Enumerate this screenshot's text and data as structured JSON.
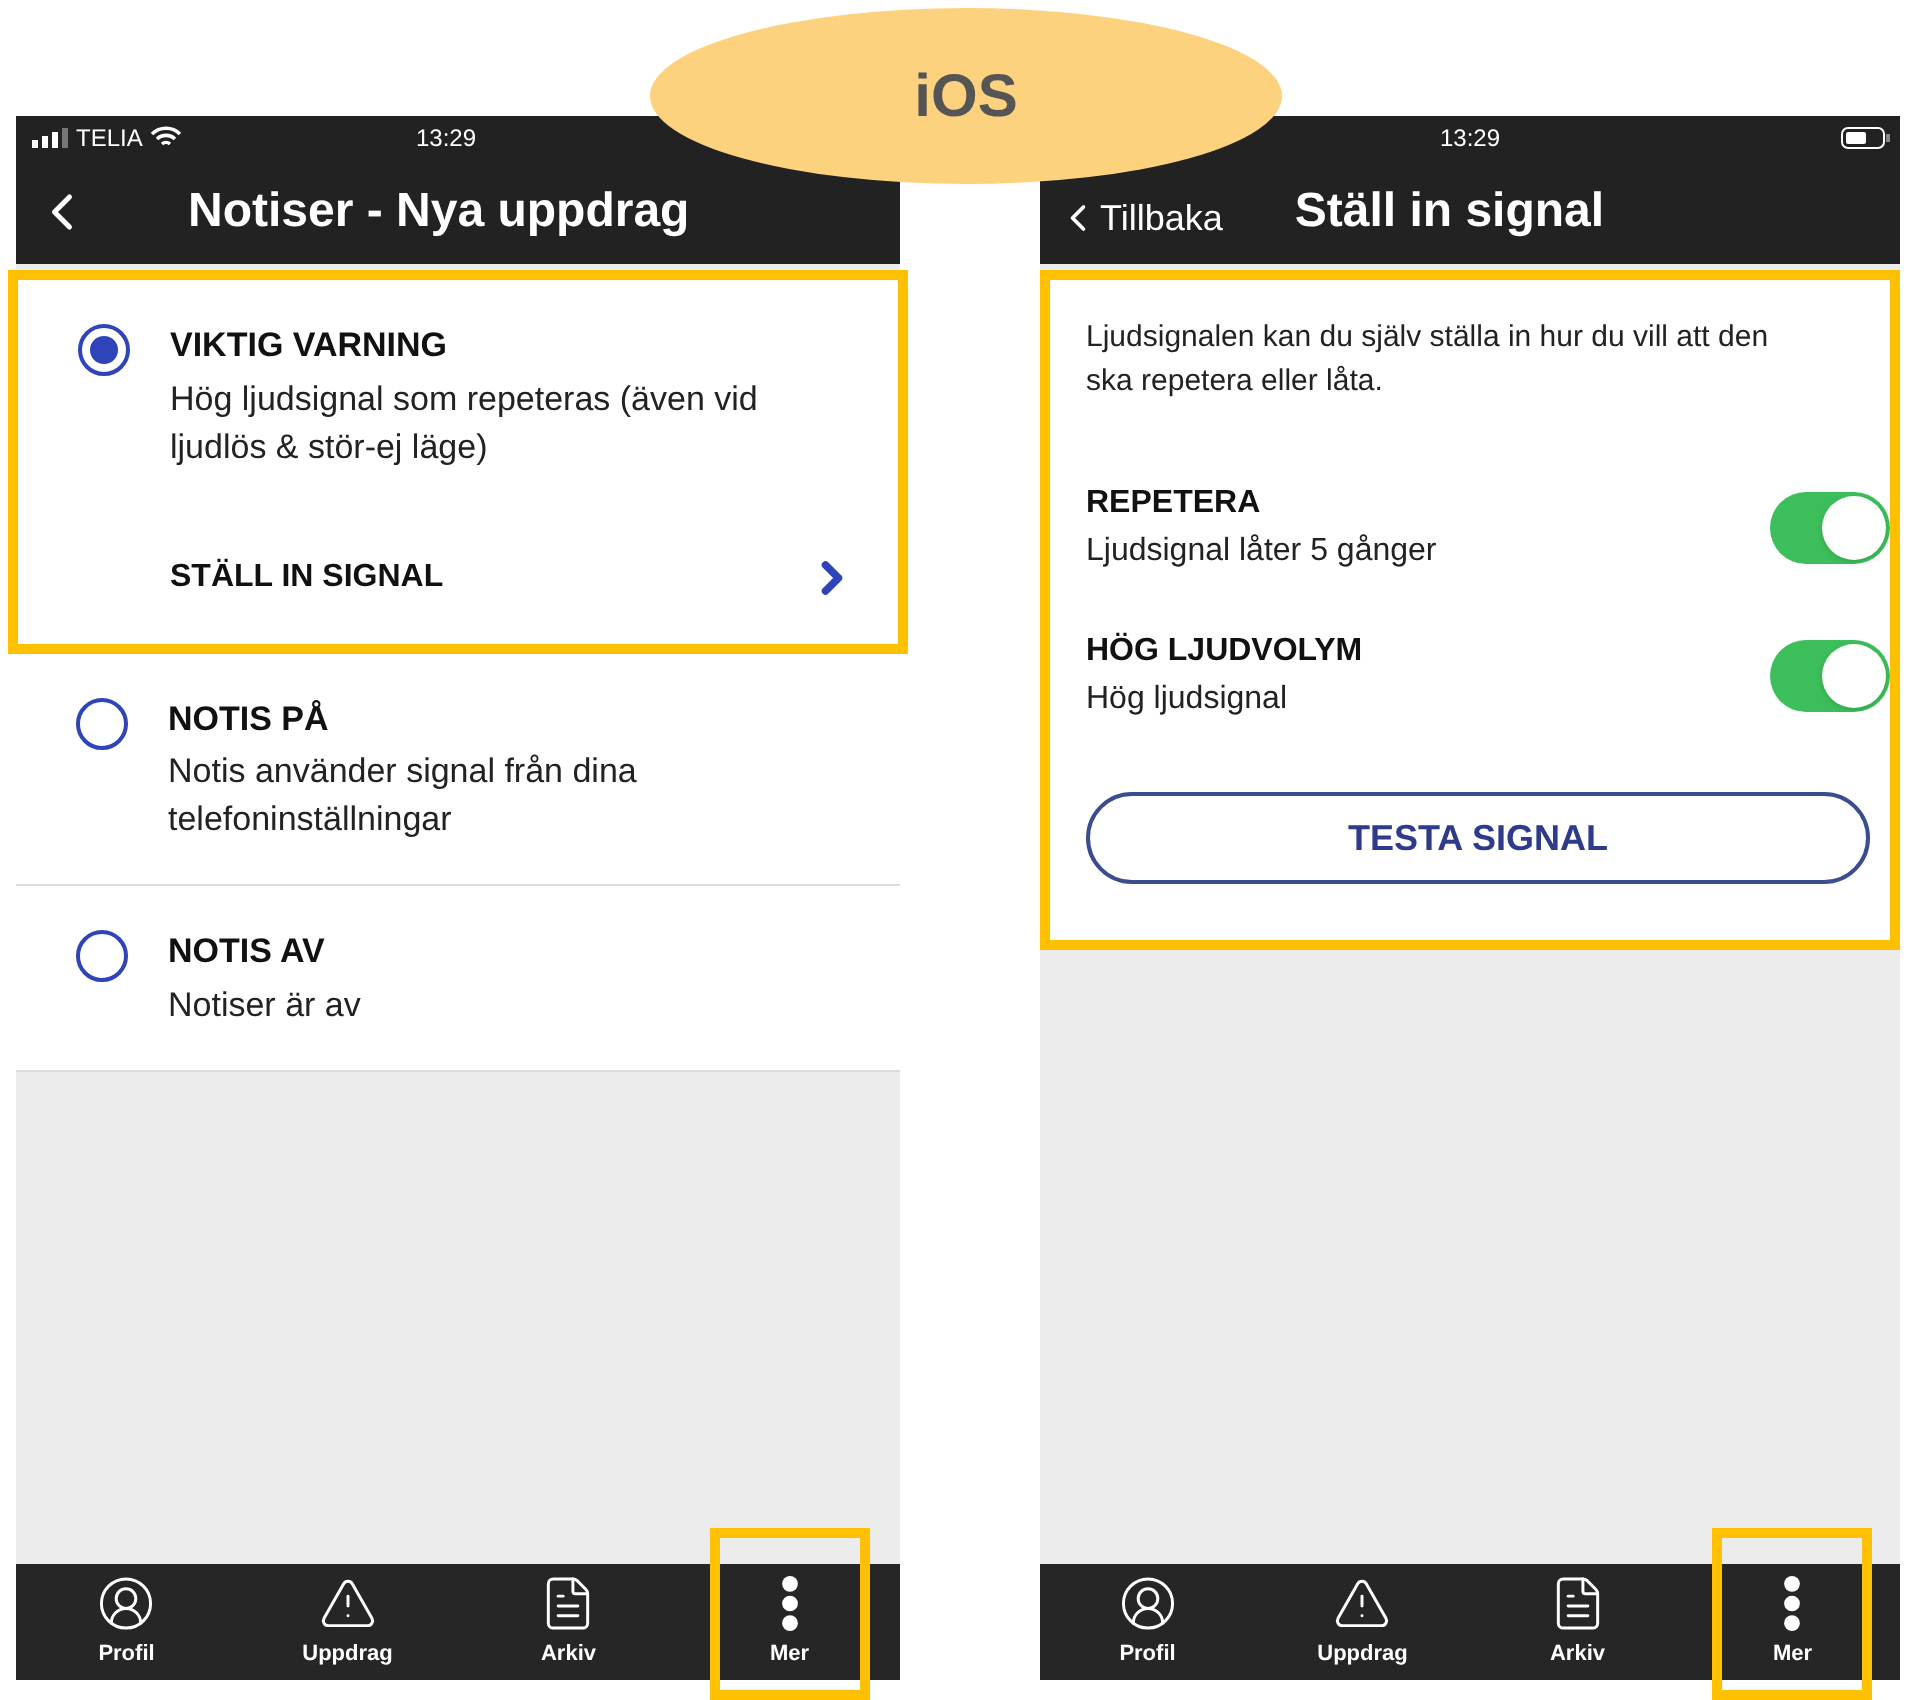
{
  "annotation": {
    "label": "iOS"
  },
  "left_screen": {
    "status_bar": {
      "carrier": "TELIA",
      "time": "13:29"
    },
    "nav": {
      "title": "Notiser - Nya uppdrag"
    },
    "options": [
      {
        "title": "VIKTIG VARNING",
        "description": "Hög ljudsignal som repeteras (även vid ljudlös & stör-ej läge)",
        "selected": true,
        "highlighted": true,
        "link": "STÄLL IN SIGNAL"
      },
      {
        "title": "NOTIS PÅ",
        "description": "Notis använder signal från dina telefoninställningar",
        "selected": false,
        "highlighted": false
      },
      {
        "title": "NOTIS AV",
        "description": "Notiser är av",
        "selected": false,
        "highlighted": false
      }
    ],
    "tab_bar": [
      {
        "label": "Profil",
        "kind": "profile",
        "highlighted": false
      },
      {
        "label": "Uppdrag",
        "kind": "alert",
        "highlighted": false
      },
      {
        "label": "Arkiv",
        "kind": "document",
        "highlighted": false
      },
      {
        "label": "Mer",
        "kind": "more",
        "highlighted": true
      }
    ]
  },
  "right_screen": {
    "status_bar": {
      "time": "13:29"
    },
    "nav": {
      "back": "Tillbaka",
      "title": "Ställ in signal"
    },
    "highlighted": true,
    "intro": "Ljudsignalen kan du själv ställa in hur du vill att den ska repetera eller låta.",
    "settings": [
      {
        "title": "REPETERA",
        "description": "Ljudsignal låter 5 gånger",
        "on": true
      },
      {
        "title": "HÖG LJUDVOLYM",
        "description": "Hög ljudsignal",
        "on": true
      }
    ],
    "button": "TESTA SIGNAL",
    "tab_bar": [
      {
        "label": "Profil",
        "kind": "profile",
        "highlighted": false
      },
      {
        "label": "Uppdrag",
        "kind": "alert",
        "highlighted": false
      },
      {
        "label": "Arkiv",
        "kind": "document",
        "highlighted": false
      },
      {
        "label": "Mer",
        "kind": "more",
        "highlighted": true
      }
    ]
  }
}
